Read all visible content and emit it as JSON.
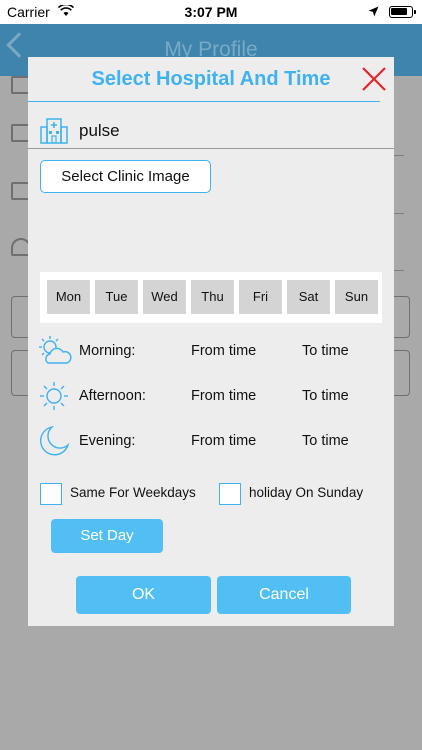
{
  "status_bar": {
    "carrier": "Carrier",
    "time": "3:07 PM"
  },
  "header": {
    "title": "My Profile"
  },
  "dialog": {
    "title": "Select Hospital And Time",
    "hospital_name": "pulse",
    "clinic_image_label": "Select Clinic Image",
    "days": [
      "Mon",
      "Tue",
      "Wed",
      "Thu",
      "Fri",
      "Sat",
      "Sun"
    ],
    "periods": [
      {
        "label": "Morning:",
        "from": "From time",
        "to": "To time",
        "icon": "cloud-sun-icon"
      },
      {
        "label": "Afternoon:",
        "from": "From time",
        "to": "To time",
        "icon": "sun-icon"
      },
      {
        "label": "Evening:",
        "from": "From time",
        "to": "To time",
        "icon": "moon-icon"
      }
    ],
    "same_for_weekdays_label": "Same For Weekdays",
    "holiday_on_sunday_label": "holiday On Sunday",
    "set_day_label": "Set Day",
    "ok_label": "OK",
    "cancel_label": "Cancel"
  },
  "colors": {
    "accent": "#3fb2ef",
    "button": "#52bff4",
    "close": "#e8232b",
    "header_bg": "#3f84ad",
    "overlay_bg": "#a9a9a9"
  }
}
